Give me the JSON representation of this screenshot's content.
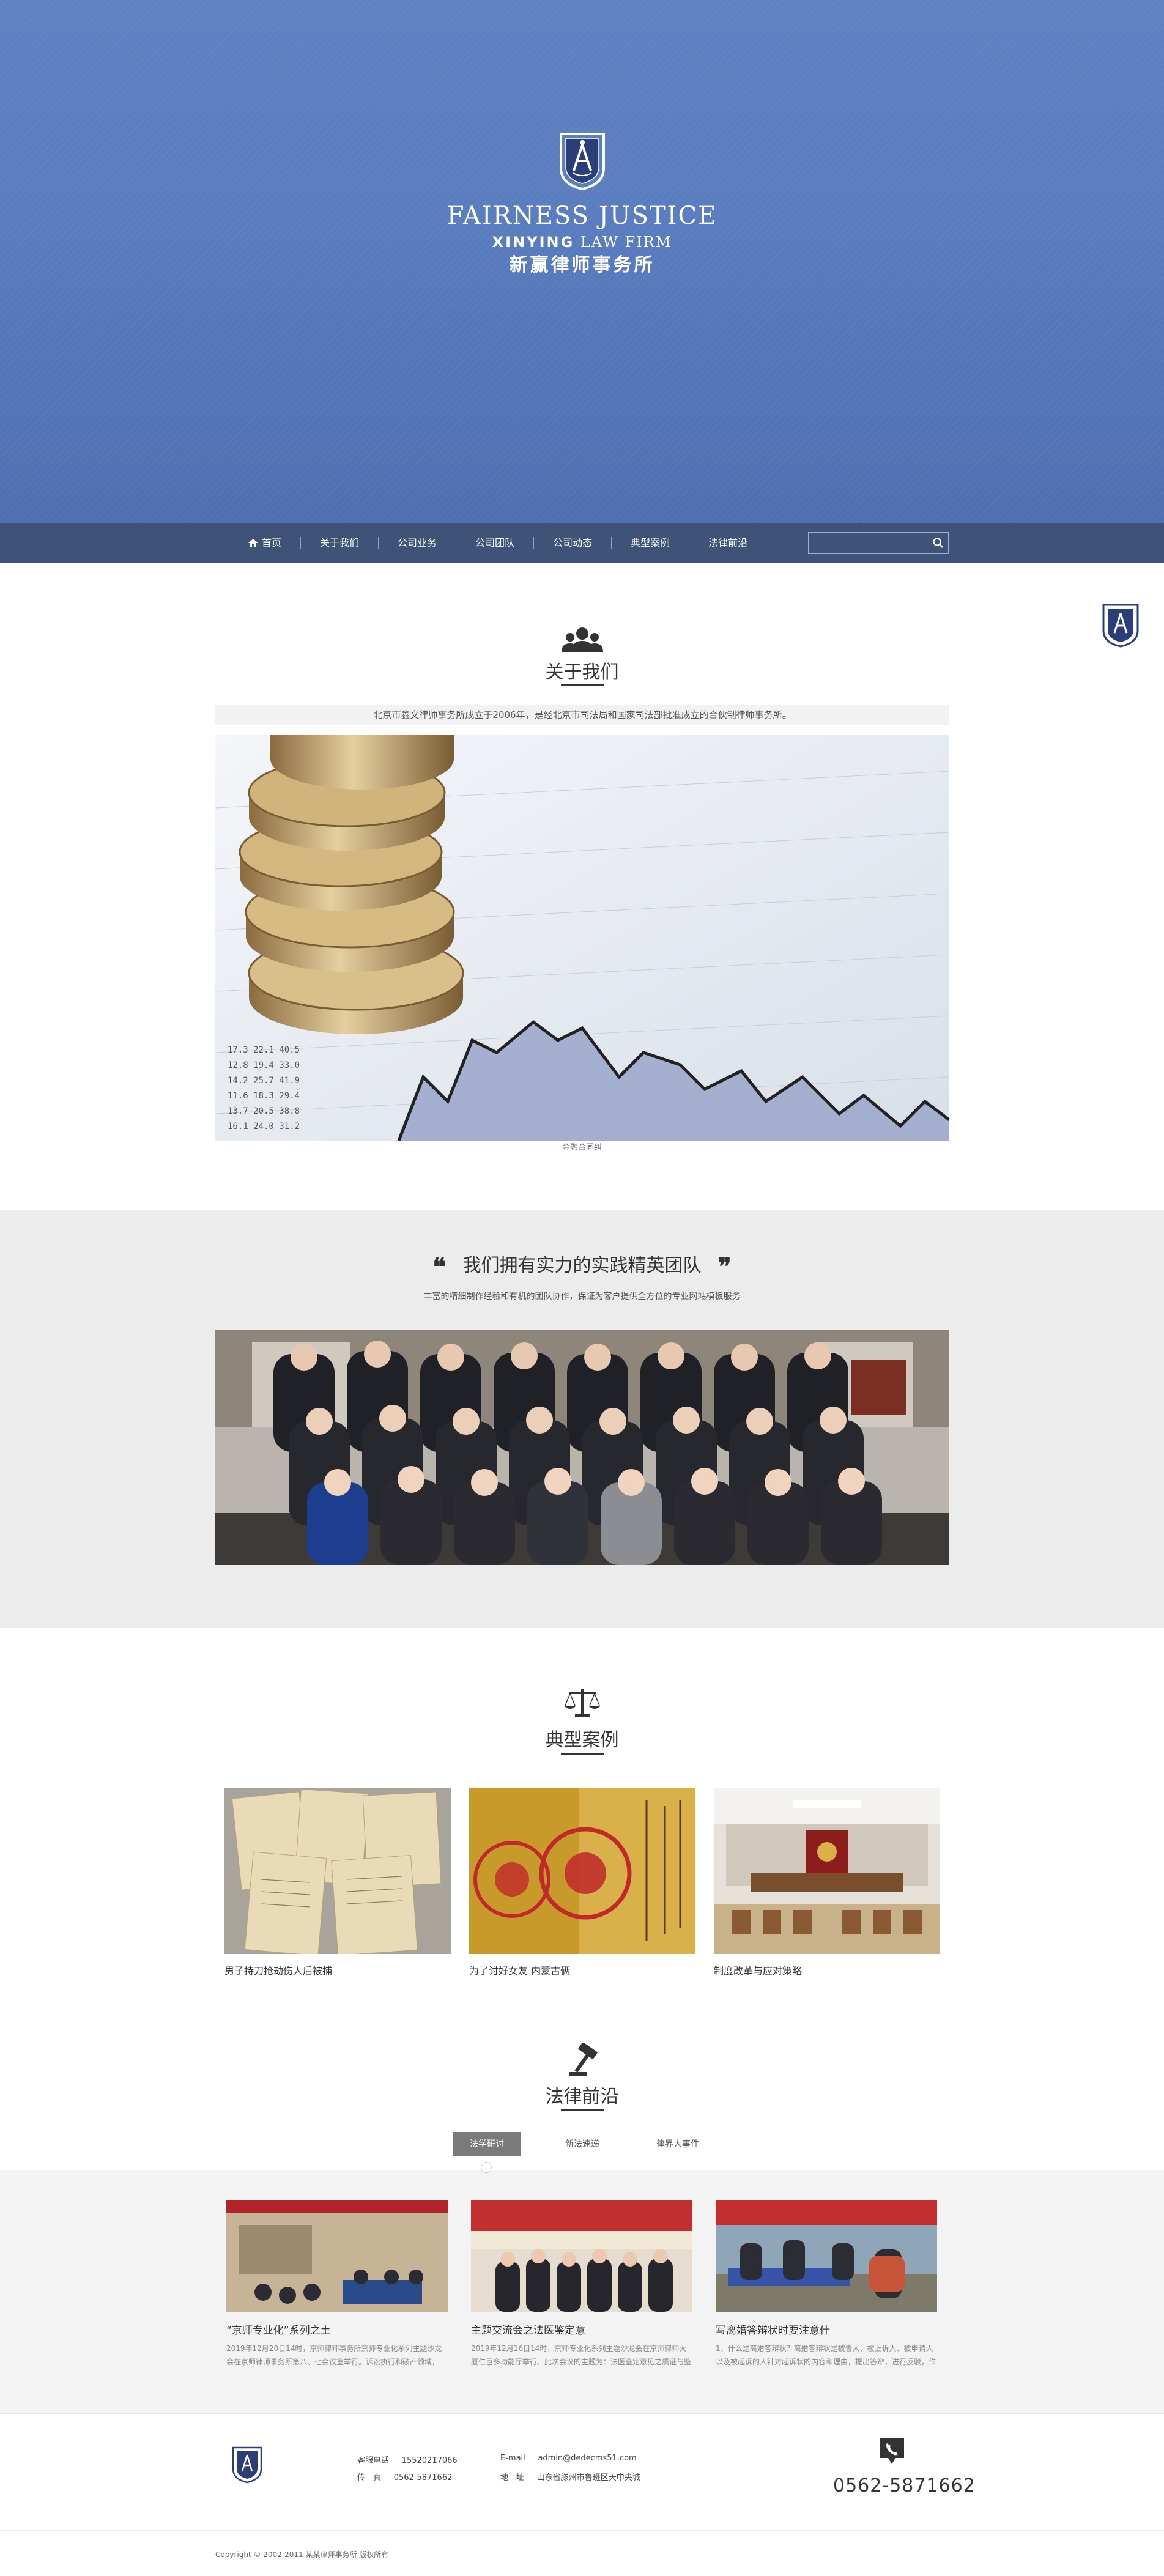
{
  "hero": {
    "title": "FAIRNESS JUSTICE",
    "subtitle_bold": "XINYING",
    "subtitle_rest": "LAW FIRM",
    "name_cn": "新赢律师事务所",
    "background_color": "#5a7dc0"
  },
  "nav": {
    "items": [
      {
        "label": "首页",
        "icon": "home-icon"
      },
      {
        "label": "关于我们"
      },
      {
        "label": "公司业务"
      },
      {
        "label": "公司团队"
      },
      {
        "label": "公司动态"
      },
      {
        "label": "典型案例"
      },
      {
        "label": "法律前沿"
      }
    ],
    "search_placeholder": "",
    "background_color": "#3e5377"
  },
  "about": {
    "icon": "people-icon",
    "title": "关于我们",
    "intro": "北京市鑫文律师事务所成立于2006年，是经北京市司法局和国家司法部批准成立的合伙制律师事务所。",
    "image_caption": "金融合同纠"
  },
  "team": {
    "title": "我们拥有实力的实践精英团队",
    "open_quote": "❝",
    "close_quote": "❞",
    "subtitle": "丰富的精细制作经验和有机的团队协作，保证为客户提供全方位的专业网站模板服务"
  },
  "cases": {
    "icon": "scales-icon",
    "title": "典型案例",
    "items": [
      {
        "label": "男子持刀抢劫伤人后被捕"
      },
      {
        "label": "为了讨好女友 内蒙古俩"
      },
      {
        "label": "制度改革与应对策略"
      }
    ]
  },
  "law": {
    "icon": "gavel-icon",
    "title": "法律前沿",
    "tabs": [
      "法学研讨",
      "新法速递",
      "律界大事件"
    ],
    "active_tab": 0,
    "news": [
      {
        "title": "“京师专业化”系列之土",
        "desc": "2019年12月20日14时，京师律师事务所京师专业化系列主题沙龙会在京师律师事务所第八、七会议室举行。诉讼执行和破产领域，本..."
      },
      {
        "title": "主题交流会之法医鉴定意",
        "desc": "2019年12月16日14时，京师专业化系列主题沙龙会在京师律师大厦仁巨多功能厅举行。此次会议的主题为：法医鉴定意见之质证与鉴定..."
      },
      {
        "title": "写离婚答辩状时要注意什",
        "desc": "1、什么是离婚答辩状？离婚答辩状是被告人、被上诉人、被申请人以及被起诉的人针对起诉状的内容和理由，提出答辩，进行反驳，作出..."
      }
    ]
  },
  "footer": {
    "hotline_label": "客服电话",
    "hotline": "15520217066",
    "fax_label": "传　真",
    "fax": "0562-5871662",
    "email_label": "E-mail",
    "email": "admin@dedecms51.com",
    "address_label": "地　址",
    "address": "山东省滕州市鲁班区天中央城",
    "phone_big": "0562-5871662",
    "copyright": "Copyright © 2002-2011 某某律师事务所 版权所有"
  }
}
